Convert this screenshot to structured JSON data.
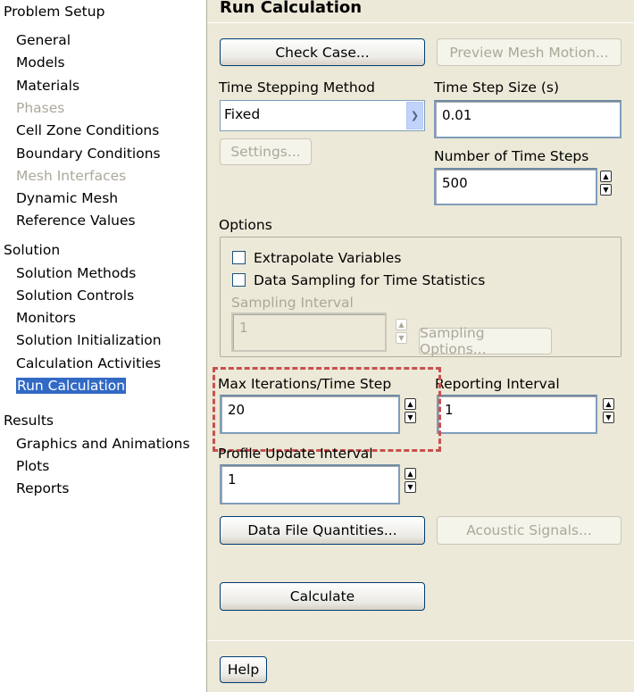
{
  "tree": {
    "sections": [
      {
        "label": "Problem Setup",
        "items": [
          {
            "label": "General"
          },
          {
            "label": "Models"
          },
          {
            "label": "Materials"
          },
          {
            "label": "Phases",
            "disabled": true
          },
          {
            "label": "Cell Zone Conditions"
          },
          {
            "label": "Boundary Conditions"
          },
          {
            "label": "Mesh Interfaces",
            "disabled": true
          },
          {
            "label": "Dynamic Mesh"
          },
          {
            "label": "Reference Values"
          }
        ]
      },
      {
        "label": "Solution",
        "items": [
          {
            "label": "Solution Methods"
          },
          {
            "label": "Solution Controls"
          },
          {
            "label": "Monitors"
          },
          {
            "label": "Solution Initialization"
          },
          {
            "label": "Calculation Activities"
          },
          {
            "label": "Run Calculation",
            "selected": true
          }
        ]
      },
      {
        "label": "Results",
        "items": [
          {
            "label": "Graphics and Animations"
          },
          {
            "label": "Plots"
          },
          {
            "label": "Reports"
          }
        ]
      }
    ]
  },
  "panel": {
    "title": "Run Calculation",
    "check_case": "Check Case...",
    "preview_mesh_motion": "Preview Mesh Motion...",
    "time_stepping_method_label": "Time Stepping Method",
    "time_stepping_method_value": "Fixed",
    "time_step_size_label": "Time Step Size (s)",
    "time_step_size_value": "0.01",
    "settings": "Settings...",
    "num_time_steps_label": "Number of Time Steps",
    "num_time_steps_value": "500",
    "options_label": "Options",
    "extrapolate_variables": "Extrapolate Variables",
    "data_sampling": "Data Sampling for Time Statistics",
    "sampling_interval_label": "Sampling Interval",
    "sampling_interval_value": "1",
    "sampling_options": "Sampling Options...",
    "max_iterations_label": "Max Iterations/Time Step",
    "max_iterations_value": "20",
    "reporting_interval_label": "Reporting Interval",
    "reporting_interval_value": "1",
    "profile_update_label": "Profile Update Interval",
    "profile_update_value": "1",
    "data_file_quantities": "Data File Quantities...",
    "acoustic_signals": "Acoustic Signals...",
    "calculate": "Calculate",
    "help": "Help"
  },
  "colors": {
    "highlight": "#c8504e",
    "selection": "#316ac5"
  }
}
